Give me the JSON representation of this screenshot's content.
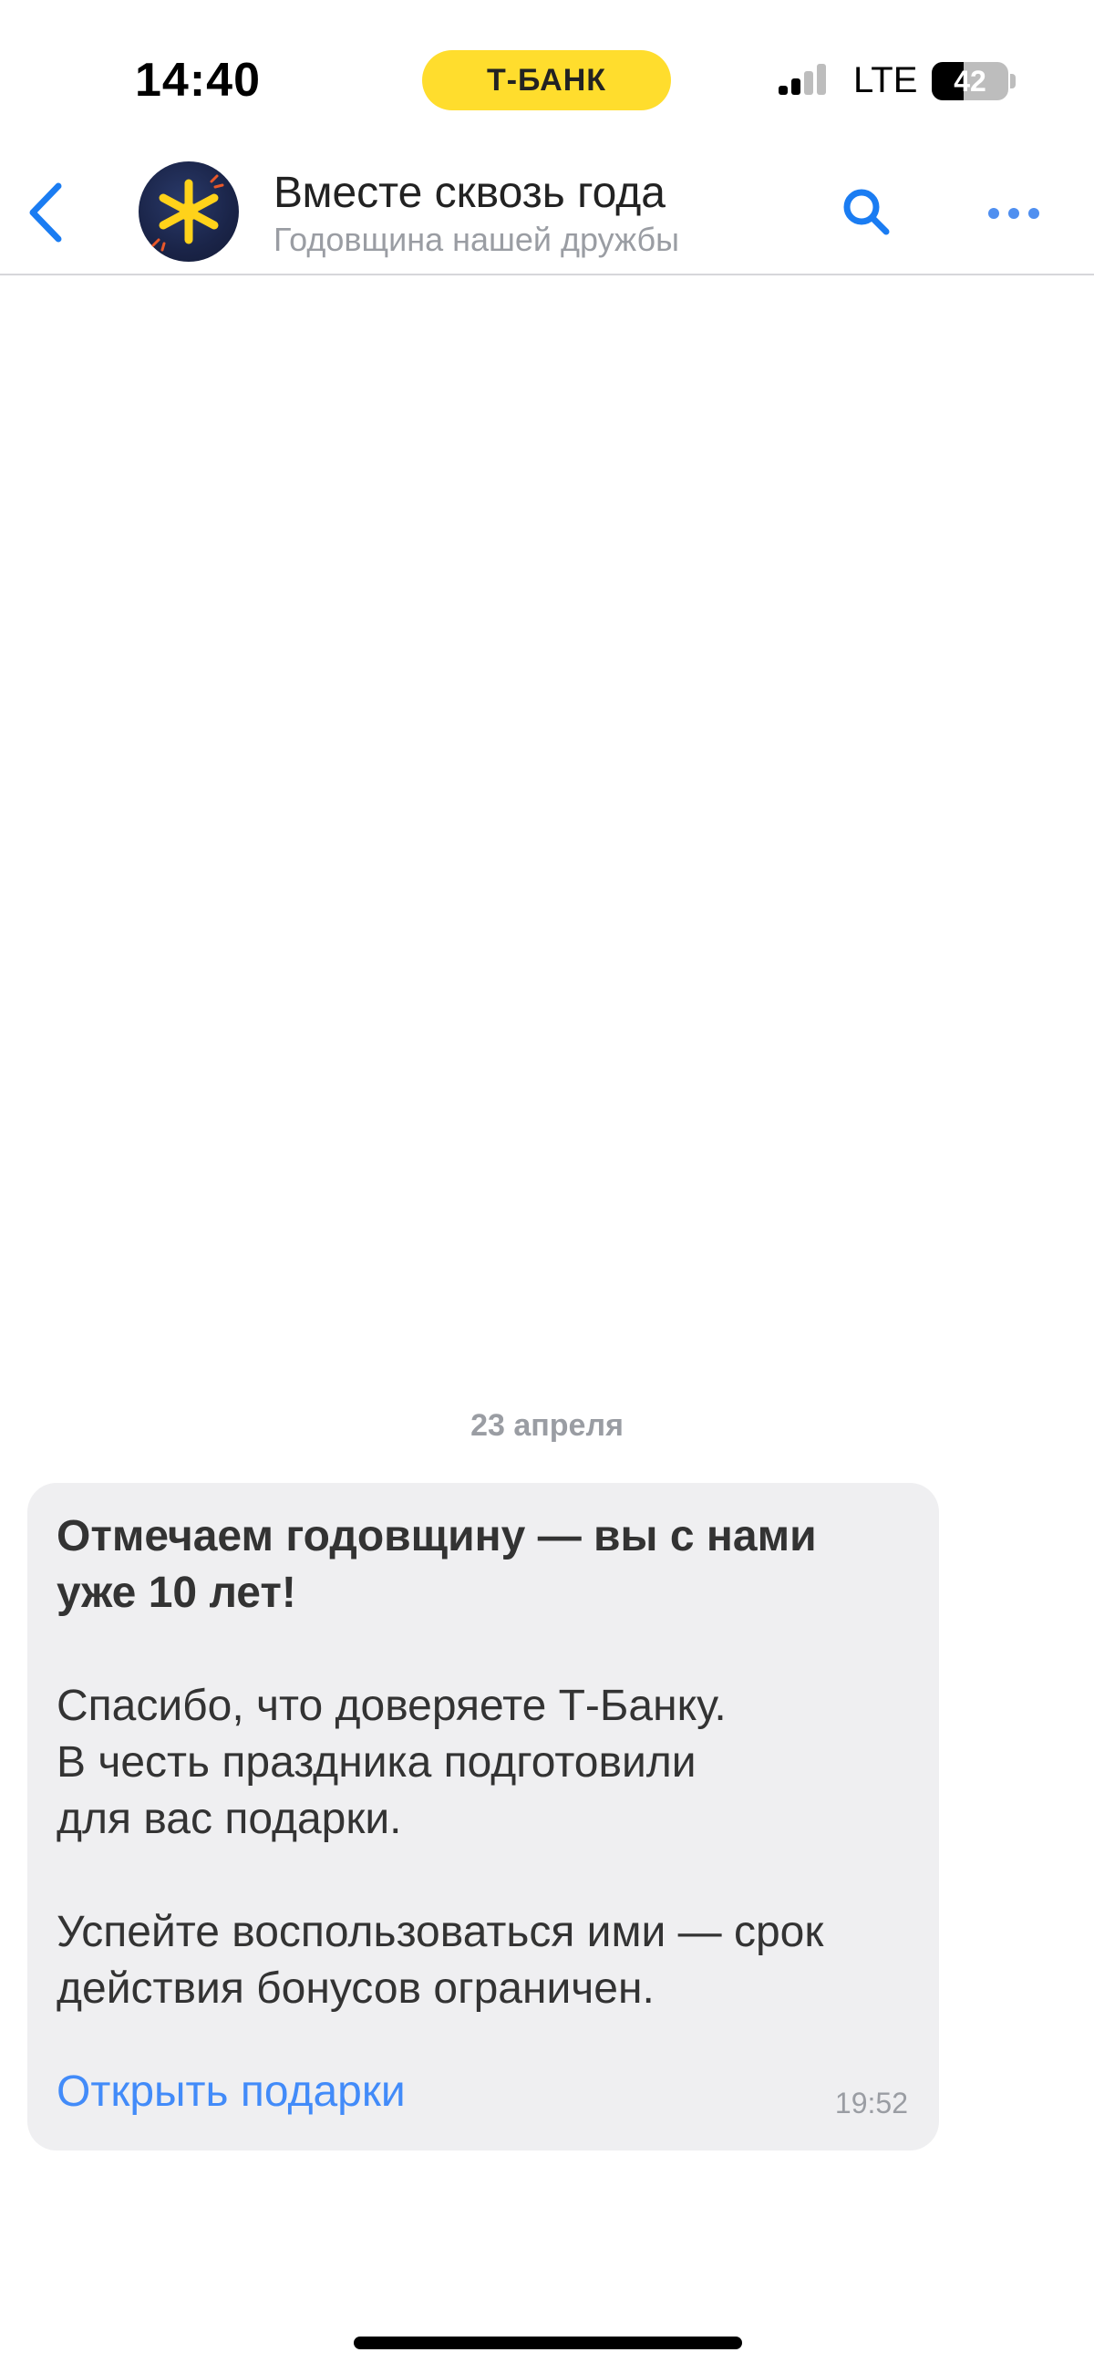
{
  "status_bar": {
    "time": "14:40",
    "bank_name": "Т-БАНК",
    "network": "LTE",
    "battery": "42",
    "battery_level": 0.42
  },
  "header": {
    "title": "Вместе сквозь года",
    "subtitle": "Годовщина нашей дружбы",
    "back_icon": "chevron-left-icon",
    "search_icon": "search-icon",
    "more_icon": "ellipsis-icon",
    "avatar_icon": "star-burst-icon",
    "accent_color": "#1a7cf2"
  },
  "chat": {
    "date_divider": "23 апреля",
    "message": {
      "heading": "Отмечаем годовщину — вы с нами уже 10 лет!",
      "paragraph_1": "Спасибо, что доверяете Т-Банку.\nВ честь праздника подготовили\nдля вас подарки.",
      "paragraph_2": "Успейте воспользоваться ими — срок\nдействия бонусов ограничен.",
      "link_label": "Открыть подарки",
      "time": "19:52",
      "bubble_color": "#efeff1",
      "link_color": "#428bf9"
    }
  }
}
